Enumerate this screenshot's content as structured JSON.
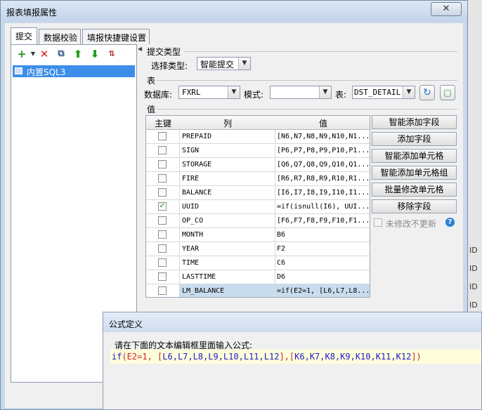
{
  "window": {
    "title": "报表填报属性",
    "close_label": "✕"
  },
  "tabs": [
    {
      "label": "提交"
    },
    {
      "label": "数据校验"
    },
    {
      "label": "填报快捷键设置"
    }
  ],
  "tree": {
    "items": [
      {
        "label": "内置SQL3"
      }
    ]
  },
  "submit_type": {
    "group_label": "提交类型",
    "select_label": "选择类型:",
    "value": "智能提交"
  },
  "table_group": {
    "group_label": "表",
    "db_label": "数据库:",
    "db_value": "FXRL",
    "mode_label": "模式:",
    "mode_value": "",
    "table_label": "表:",
    "table_value": "DST_DETAIL"
  },
  "values_group": {
    "group_label": "值",
    "headers": {
      "key": "主键",
      "column": "列",
      "value": "值"
    },
    "rows": [
      {
        "key": false,
        "column": "PREPAID",
        "value": "[N6,N7,N8,N9,N10,N1..."
      },
      {
        "key": false,
        "column": "SIGN",
        "value": "[P6,P7,P8,P9,P10,P1..."
      },
      {
        "key": false,
        "column": "STORAGE",
        "value": "[Q6,Q7,Q8,Q9,Q10,Q1..."
      },
      {
        "key": false,
        "column": "FIRE",
        "value": "[R6,R7,R8,R9,R10,R1..."
      },
      {
        "key": false,
        "column": "BALANCE",
        "value": "[I6,I7,I8,I9,I10,I1..."
      },
      {
        "key": true,
        "column": "UUID",
        "value": "=if(isnull(I6), UUI..."
      },
      {
        "key": false,
        "column": "OP_CO",
        "value": "[F6,F7,F8,F9,F10,F1..."
      },
      {
        "key": false,
        "column": "MONTH",
        "value": "B6"
      },
      {
        "key": false,
        "column": "YEAR",
        "value": "F2"
      },
      {
        "key": false,
        "column": "TIME",
        "value": "C6"
      },
      {
        "key": false,
        "column": "LASTTIME",
        "value": "D6"
      },
      {
        "key": false,
        "column": "LM_BALANCE",
        "value": "=if(E2=1, [L6,L7,L8..."
      }
    ],
    "buttons": [
      "智能添加字段",
      "添加字段",
      "智能添加单元格",
      "智能添加单元格组",
      "批量修改单元格",
      "移除字段"
    ],
    "checkbox_label": "未修改不更新"
  },
  "formula_dialog": {
    "title": "公式定义",
    "prompt": "请在下面的文本编辑框里面输入公式:",
    "tokens": [
      "if",
      "(E2=1, ",
      "[",
      "L6,L7,L8,L9,L10,L11,L12",
      "]",
      ",",
      "[",
      "K6,K7,K8,K9,K10,K11,K12",
      "]",
      ")"
    ]
  },
  "background": {
    "fragments": [
      "ID",
      "ID",
      "ID",
      "ID"
    ]
  }
}
